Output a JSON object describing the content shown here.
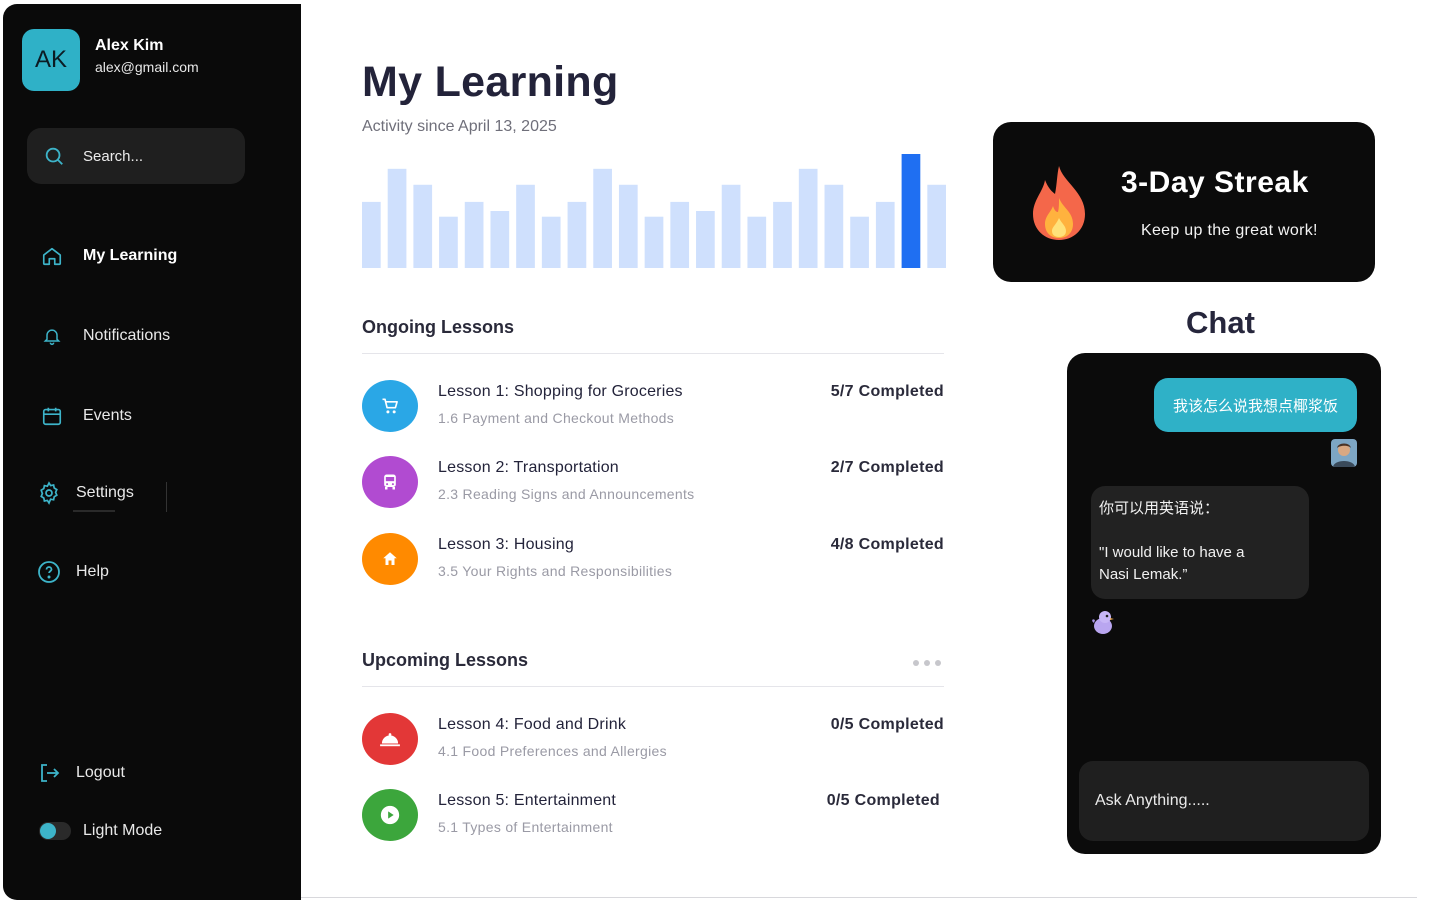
{
  "user": {
    "initials": "AK",
    "name": "Alex Kim",
    "email": "alex@gmail.com"
  },
  "search": {
    "placeholder": "Search..."
  },
  "nav": {
    "my_learning": "My Learning",
    "notifications": "Notifications",
    "events": "Events",
    "settings": "Settings",
    "help": "Help",
    "logout": "Logout",
    "light_mode": "Light Mode"
  },
  "main": {
    "title": "My Learning",
    "subtitle": "Activity since April 13, 2025",
    "ongoing_title": "Ongoing Lessons",
    "upcoming_title": "Upcoming Lessons"
  },
  "chart_data": {
    "type": "bar",
    "values": [
      0.58,
      0.87,
      0.73,
      0.45,
      0.58,
      0.5,
      0.73,
      0.45,
      0.58,
      0.87,
      0.73,
      0.45,
      0.58,
      0.5,
      0.73,
      0.45,
      0.58,
      0.87,
      0.73,
      0.45,
      0.58,
      1.0,
      0.73
    ],
    "highlight_index": 21,
    "bar_color": "#cfe0fd",
    "highlight_color": "#1f6ff2"
  },
  "ongoing": [
    {
      "title": "Lesson 1: Shopping for Groceries",
      "sub": "1.6 Payment and Checkout Methods",
      "progress": "5/7  Completed",
      "color": "#2aa7e6",
      "icon": "cart-icon"
    },
    {
      "title": "Lesson 2: Transportation",
      "sub": "2.3 Reading Signs and Announcements",
      "progress": "2/7 Completed",
      "color": "#b14bd1",
      "icon": "bus-icon"
    },
    {
      "title": "Lesson 3: Housing",
      "sub": "3.5 Your Rights and Responsibilities",
      "progress": "4/8 Completed",
      "color": "#ff8a00",
      "icon": "home-icon"
    }
  ],
  "upcoming": [
    {
      "title": "Lesson 4: Food and Drink",
      "sub": "4.1 Food Preferences and Allergies",
      "progress": "0/5 Completed",
      "color": "#e33737",
      "icon": "cloche-icon"
    },
    {
      "title": "Lesson 5: Entertainment",
      "sub": "5.1 Types of Entertainment",
      "progress": "0/5 Completed",
      "color": "#3ca63c",
      "icon": "play-icon"
    }
  ],
  "streak": {
    "title": "3-Day Streak",
    "subtitle": "Keep up the great work!"
  },
  "chat": {
    "title": "Chat",
    "user_message": "我该怎么说我想点椰浆饭",
    "bot_line1": "你可以用英语说：",
    "bot_line2": "\"I would like to have a",
    "bot_line3": "Nasi Lemak.”",
    "input_placeholder": "Ask Anything....."
  }
}
